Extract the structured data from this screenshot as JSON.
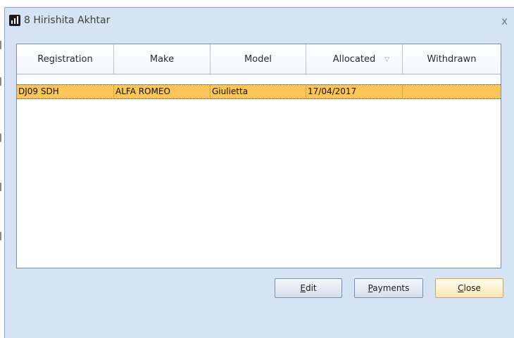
{
  "window": {
    "title": "8 Hirishita Akhtar",
    "close_glyph": "x",
    "icon": "bar-chart-icon"
  },
  "grid": {
    "columns": [
      {
        "label": "Registration"
      },
      {
        "label": "Make"
      },
      {
        "label": "Model"
      },
      {
        "label": "Allocated",
        "sort_icon": "▽"
      },
      {
        "label": "Withdrawn"
      }
    ],
    "rows": [
      {
        "registration": "DJ09 SDH",
        "make": "ALFA ROMEO",
        "model": "Giulietta",
        "allocated": "17/04/2017",
        "withdrawn": ""
      }
    ],
    "selected_row_color": "#fbc657"
  },
  "buttons": {
    "edit": {
      "label": "Edit",
      "mnemonic": "E"
    },
    "payments": {
      "label": "Payments",
      "mnemonic": "P"
    },
    "close": {
      "label": "Close",
      "mnemonic": "C"
    }
  },
  "colors": {
    "window_bg": "#d6e3f4",
    "grid_bg": "#ffffff",
    "default_button": "#f9e8b4"
  }
}
